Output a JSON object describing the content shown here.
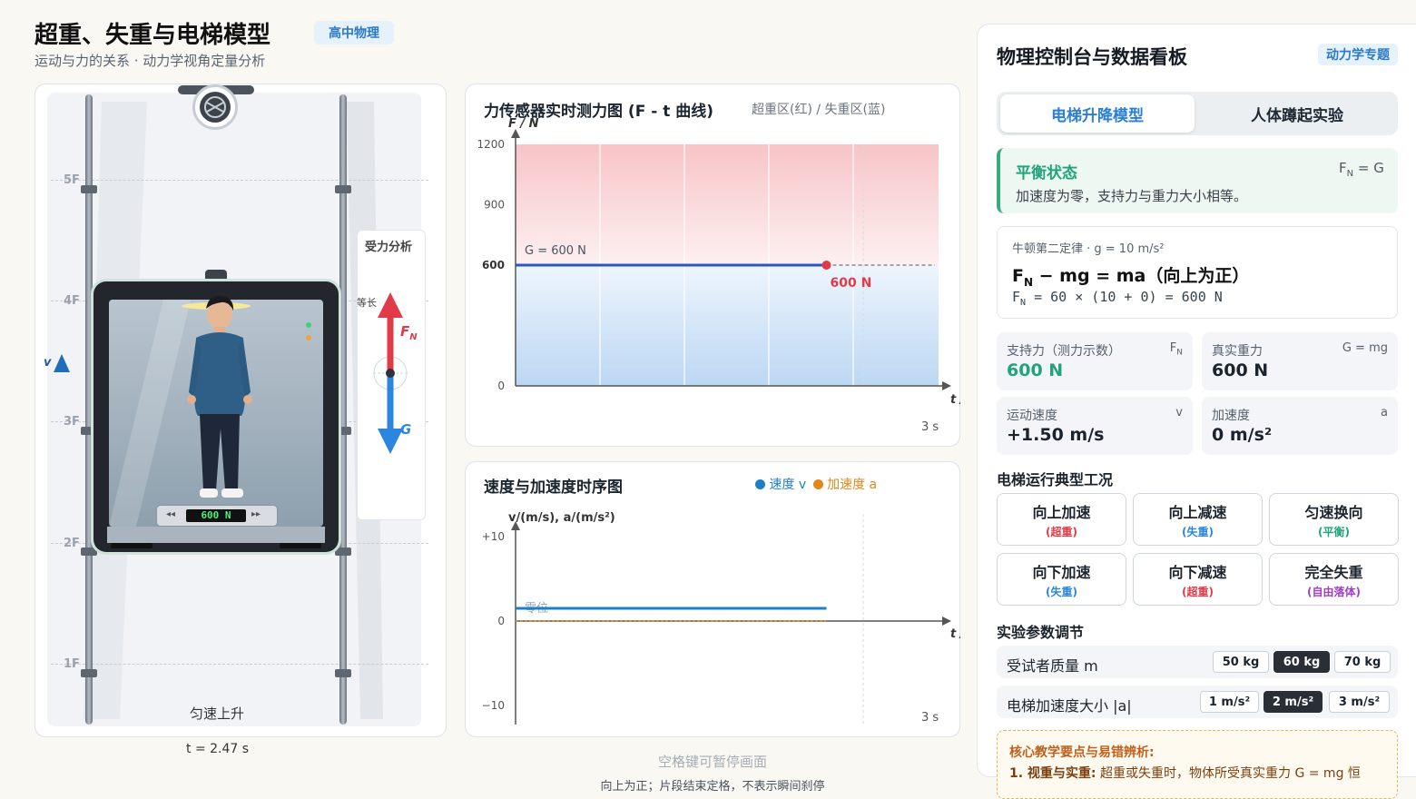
{
  "header": {
    "title": "超重、失重与电梯模型",
    "tag": "高中物理",
    "subtitle": "运动与力的关系 · 动力学视角定量分析"
  },
  "elevator": {
    "floors": [
      "5F",
      "4F",
      "3F",
      "2F",
      "1F"
    ],
    "state_label": "匀速上升",
    "time_readout": "t = 2.47 s",
    "scale_reading": "600 N",
    "velocity_symbol": "v",
    "force_panel": {
      "title": "受力分析",
      "equal_note": "等长",
      "support_force": "F",
      "support_sub": "N",
      "gravity": "G"
    },
    "colors": {
      "support": "#e23b48",
      "gravity": "#2b86e0"
    }
  },
  "force_chart": {
    "title": "力传感器实时测力图 (F - t 曲线)",
    "hint": "超重区(红) / 失重区(蓝)",
    "y_axis_label": "F / N",
    "x_axis_label": "t / s",
    "x_end_label": "3 s",
    "baseline_label": "G = 600 N",
    "current_label": "600 N",
    "chart_data": {
      "type": "line",
      "ylim": [
        0,
        1200
      ],
      "yticks": [
        0,
        600,
        900,
        1200
      ],
      "xlim": [
        0,
        3
      ],
      "x": [
        0,
        2.47
      ],
      "y": [
        600,
        600
      ],
      "colors": {
        "line": "#2a56c6",
        "point": "#e23b48",
        "overweight": "#f8c9cc",
        "weightless": "#c5dcf5"
      }
    }
  },
  "motion_chart": {
    "title": "速度与加速度时序图",
    "legend": [
      {
        "label": "速度 v",
        "color": "#1f7fc4"
      },
      {
        "label": "加速度 a",
        "color": "#e0891b"
      }
    ],
    "y_axis_label": "v/(m/s), a/(m/s²)",
    "x_axis_label": "t / s",
    "x_end_label": "3 s",
    "zero_label": "零位",
    "chart_data": {
      "type": "line",
      "ylim": [
        -10,
        10
      ],
      "yticks": [
        "+10",
        "0",
        "−10"
      ],
      "xlim": [
        0,
        3
      ],
      "series": [
        {
          "name": "速度 v",
          "x": [
            0,
            2.47
          ],
          "y": [
            1.5,
            1.5
          ],
          "color": "#1f7fc4"
        },
        {
          "name": "加速度 a",
          "x": [
            0,
            2.47
          ],
          "y": [
            0,
            0
          ],
          "color": "#e0891b"
        }
      ]
    }
  },
  "footer": {
    "pause_hint": "空格键可暂停画面",
    "note": "向上为正；片段结束定格，不表示瞬间刹停"
  },
  "dashboard": {
    "title": "物理控制台与数据看板",
    "tag": "动力学专题",
    "tabs": [
      "电梯升降模型",
      "人体蹲起实验"
    ],
    "status": {
      "title": "平衡状态",
      "relation": "F",
      "relation_sub": "N",
      "relation_tail": " = G",
      "desc": "加速度为零，支持力与重力大小相等。"
    },
    "law": {
      "caption": "牛顿第二定律 · g = 10 m/s²",
      "main_lead": "F",
      "main_sub": "N",
      "main_tail": " − mg = ma（向上为正）",
      "calc_lead": "F",
      "calc_sub": "N",
      "calc_tail": " = 60 × (10 + 0) = 600 N"
    },
    "metrics": [
      {
        "label": "支持力（测力示数）",
        "symbol": "F",
        "symbol_sub": "N",
        "value": "600 N",
        "color": "#22a37a"
      },
      {
        "label": "真实重力",
        "symbol": "G = mg",
        "symbol_sub": "",
        "value": "600 N",
        "color": "#1b232c"
      },
      {
        "label": "运动速度",
        "symbol": "v",
        "symbol_sub": "",
        "value": "+1.50 m/s",
        "color": "#1b232c"
      },
      {
        "label": "加速度",
        "symbol": "a",
        "symbol_sub": "",
        "value": "0 m/s²",
        "color": "#1b232c"
      }
    ],
    "cases_title": "电梯运行典型工况",
    "cases": [
      {
        "name": "向上加速",
        "sub": "(超重)",
        "color": "#e23b48"
      },
      {
        "name": "向上减速",
        "sub": "(失重)",
        "color": "#2b86e0"
      },
      {
        "name": "匀速换向",
        "sub": "(平衡)",
        "color": "#22a37a"
      },
      {
        "name": "向下加速",
        "sub": "(失重)",
        "color": "#2b86e0"
      },
      {
        "name": "向下减速",
        "sub": "(超重)",
        "color": "#e23b48"
      },
      {
        "name": "完全失重",
        "sub": "(自由落体)",
        "color": "#a23dc4"
      }
    ],
    "params_title": "实验参数调节",
    "mass": {
      "label": "受试者质量 m",
      "options": [
        "50 kg",
        "60 kg",
        "70 kg"
      ],
      "selected": 1
    },
    "accel": {
      "label": "电梯加速度大小 |a|",
      "options": [
        "1 m/s²",
        "2 m/s²",
        "3 m/s²"
      ],
      "selected": 1
    },
    "tips": {
      "title": "核心教学要点与易错辨析:",
      "line1_lead": "1. 视重与实重:",
      "line1_body": " 超重或失重时，物体所受真实重力 G = mg 恒"
    }
  }
}
